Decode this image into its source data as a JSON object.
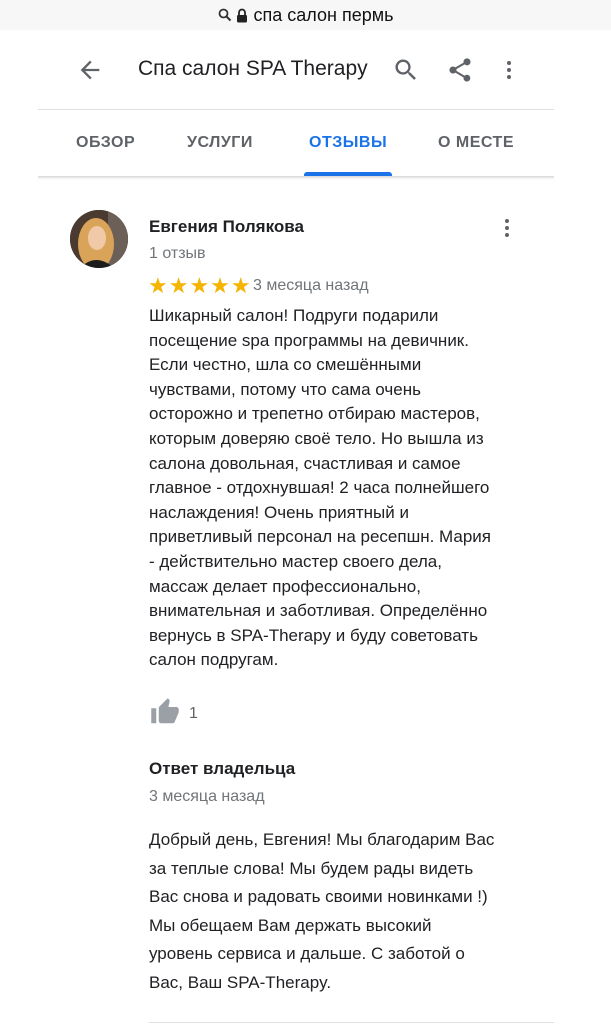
{
  "browser": {
    "url_text": "спа салон пермь",
    "search_icon": "search-icon",
    "lock_icon": "lock-icon"
  },
  "header": {
    "title": "Спа салон SPA Therapy",
    "back_icon": "arrow-back-icon",
    "search_icon": "search-icon",
    "share_icon": "share-icon",
    "more_icon": "more-vert-icon"
  },
  "tabs": [
    {
      "label": "ОБЗОР",
      "active": false
    },
    {
      "label": "УСЛУГИ",
      "active": false
    },
    {
      "label": "ОТЗЫВЫ",
      "active": true
    },
    {
      "label": "О МЕСТЕ",
      "active": false
    }
  ],
  "review": {
    "author": "Евгения Полякова",
    "author_reviews": "1 отзыв",
    "rating": 5,
    "stars": "★★★★★",
    "date": "3 месяца назад",
    "text": "Шикарный салон! Подруги подарили\nпосещение spa программы на девичник.\nЕсли честно, шла со смешёнными\nчувствами, потому что сама очень\nосторожно и трепетно отбираю мастеров,\nкоторым доверяю своё тело. Но вышла из\nсалона довольная, счастливая и самое\nглавное - отдохнувшая! 2 часа полнейшего\nнаслаждения! Очень приятный и\nприветливый персонал на ресепшн. Мария\n- действительно мастер своего дела,\nмассаж делает профессионально,\nвнимательная и заботливая. Определённо\nвернусь в SPA-Therapy и буду советовать\nсалон подругам.",
    "likes": "1",
    "like_icon": "thumb-up-icon"
  },
  "owner_response": {
    "title": "Ответ владельца",
    "date": "3 месяца назад",
    "text": "Добрый день, Евгения! Мы благодарим Вас\nза теплые слова! Мы будем рады видеть\nВас снова и радовать своими новинками !)\nМы обещаем Вам держать высокий\nуровень сервиса и дальше. С заботой о\nВас, Ваш SPA-Therapy."
  },
  "colors": {
    "accent": "#1a73e8",
    "star": "#f4b400",
    "secondary_text": "#70757a"
  }
}
